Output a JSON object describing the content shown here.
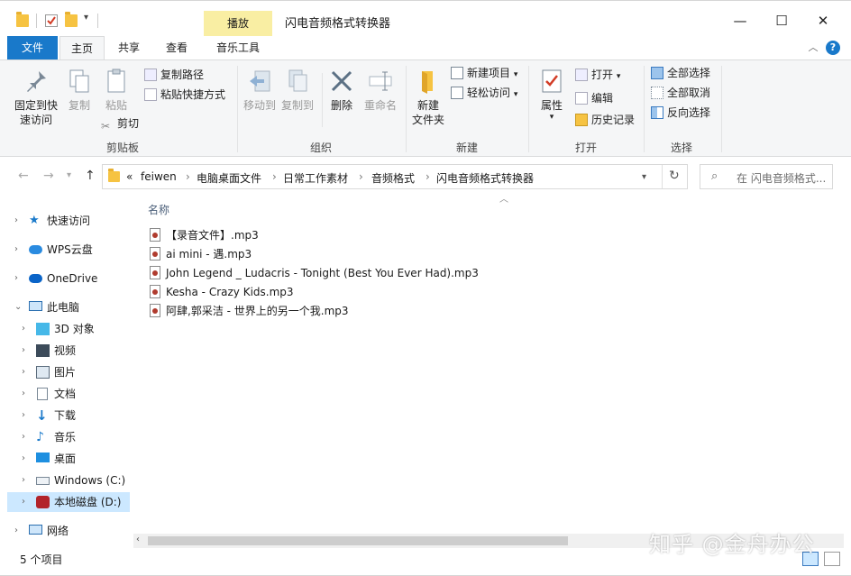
{
  "window": {
    "title": "闪电音频格式转换器",
    "context_tab_header": "播放",
    "minimize": "—",
    "maximize": "☐",
    "close": "✕"
  },
  "ribbon_tabs": [
    "文件",
    "主页",
    "共享",
    "查看",
    "音乐工具"
  ],
  "ribbon": {
    "clipboard": {
      "pin": "固定到快\n速访问",
      "copy": "复制",
      "paste": "粘贴",
      "copy_path": "复制路径",
      "paste_shortcut": "粘贴快捷方式",
      "cut": "剪切",
      "label": "剪贴板"
    },
    "organize": {
      "move_to": "移动到",
      "copy_to": "复制到",
      "delete": "删除",
      "rename": "重命名",
      "label": "组织"
    },
    "new": {
      "new_folder": "新建\n文件夹",
      "new_item": "新建项目",
      "easy_access": "轻松访问",
      "label": "新建"
    },
    "open": {
      "properties": "属性",
      "open": "打开",
      "edit": "编辑",
      "history": "历史记录",
      "label": "打开"
    },
    "select": {
      "select_all": "全部选择",
      "select_none": "全部取消",
      "invert": "反向选择",
      "label": "选择"
    }
  },
  "address": {
    "overflow": "«",
    "crumbs": [
      "feiwen",
      "电脑桌面文件",
      "日常工作素材",
      "音频格式",
      "闪电音频格式转换器"
    ],
    "search_placeholder": "在 闪电音频格式..."
  },
  "nav_pane": {
    "quick_access": "快速访问",
    "wps": "WPS云盘",
    "onedrive": "OneDrive",
    "this_pc": "此电脑",
    "objects3d": "3D 对象",
    "videos": "视频",
    "pictures": "图片",
    "documents": "文档",
    "downloads": "下载",
    "music": "音乐",
    "desktop": "桌面",
    "drive_c": "Windows (C:)",
    "drive_d": "本地磁盘 (D:)",
    "network": "网络"
  },
  "content": {
    "column_name": "名称",
    "files": [
      "【录音文件】.mp3",
      "ai mini - 遇.mp3",
      "John Legend _ Ludacris - Tonight (Best You Ever Had).mp3",
      "Kesha - Crazy Kids.mp3",
      "阿肆,郭采洁 - 世界上的另一个我.mp3"
    ]
  },
  "status": {
    "item_count": "5 个项目"
  },
  "watermark": "知乎 @金舟办公",
  "colors": {
    "file_tab": "#1979ca",
    "context_tab": "#f9eea3",
    "selection": "#cce8ff",
    "folder": "#f6c342"
  }
}
